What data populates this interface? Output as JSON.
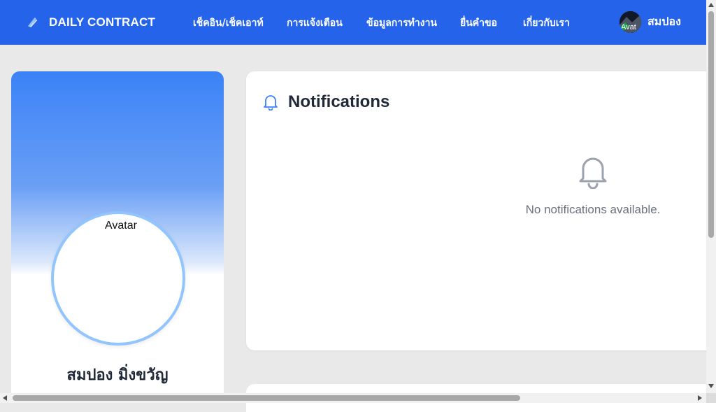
{
  "header": {
    "brand_name": "DAILY CONTRACT",
    "nav": [
      {
        "label": "เช็คอิน/เช็คเอาท์"
      },
      {
        "label": "การแจ้งเตือน"
      },
      {
        "label": "ข้อมูลการทำงาน"
      },
      {
        "label": "ยื่นคำขอ"
      },
      {
        "label": "เกี่ยวกับเรา"
      }
    ],
    "user": {
      "name": "สมปอง",
      "avatar_alt": "Avat"
    }
  },
  "profile": {
    "avatar_alt": "Avatar",
    "full_name": "สมปอง มิ่งขวัญ"
  },
  "notifications": {
    "title": "Notifications",
    "empty_message": "No notifications available."
  },
  "colors": {
    "primary": "#2563eb",
    "avatar_border": "#93c5fd",
    "muted_text": "#6b7280",
    "page_bg": "#e9e9e9"
  },
  "icons": {
    "brand": "logo-icon",
    "notifications_header": "bell-icon",
    "empty_state": "bell-icon"
  }
}
